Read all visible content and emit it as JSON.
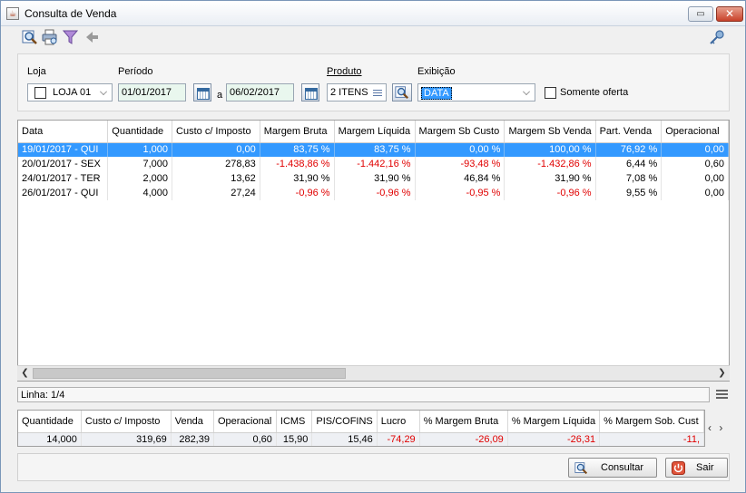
{
  "window": {
    "title": "Consulta de Venda",
    "title_icon": "java-cup-icon"
  },
  "toolbar": {
    "icons": [
      "search-icon",
      "print-icon",
      "filter-icon",
      "back-arrow-icon",
      "key-icon"
    ]
  },
  "filters": {
    "loja_label": "Loja",
    "loja_value": "LOJA 01",
    "periodo_label": "Período",
    "date_from": "01/01/2017",
    "a_label": "a",
    "date_to": "06/02/2017",
    "produto_label": "Produto",
    "produto_value": "2 ITENS",
    "exibicao_label": "Exibição",
    "exibicao_value": "DATA",
    "somente_oferta_label": "Somente oferta"
  },
  "grid": {
    "columns": [
      "Data",
      "Quantidade",
      "Custo c/ Imposto",
      "Margem Bruta",
      "Margem Líquida",
      "Margem Sb Custo",
      "Margem Sb Venda",
      "Part. Venda",
      "Operacional"
    ],
    "rows": [
      [
        "19/01/2017 - QUI",
        "1,000",
        "0,00",
        "83,75 %",
        "83,75 %",
        "0,00 %",
        "100,00 %",
        "76,92 %",
        "0,00"
      ],
      [
        "20/01/2017 - SEX",
        "7,000",
        "278,83",
        "-1.438,86 %",
        "-1.442,16 %",
        "-93,48 %",
        "-1.432,86 %",
        "6,44 %",
        "0,60"
      ],
      [
        "24/01/2017 - TER",
        "2,000",
        "13,62",
        "31,90 %",
        "31,90 %",
        "46,84 %",
        "31,90 %",
        "7,08 %",
        "0,00"
      ],
      [
        "26/01/2017 - QUI",
        "4,000",
        "27,24",
        "-0,96 %",
        "-0,96 %",
        "-0,95 %",
        "-0,96 %",
        "9,55 %",
        "0,00"
      ]
    ]
  },
  "status": {
    "linha": "Linha: 1/4"
  },
  "totals": {
    "columns": [
      "Quantidade",
      "Custo c/ Imposto",
      "Venda",
      "Operacional",
      "ICMS",
      "PIS/COFINS",
      "Lucro",
      "% Margem Bruta",
      "% Margem Líquida",
      "% Margem Sob. Cust"
    ],
    "values": [
      "14,000",
      "319,69",
      "282,39",
      "0,60",
      "15,90",
      "15,46",
      "-74,29",
      "-26,09",
      "-26,31",
      "-11,"
    ]
  },
  "buttons": {
    "consultar": "Consultar",
    "sair": "Sair"
  },
  "colors": {
    "selection": "#3399ff",
    "negative": "#e00000",
    "date_field": "#e9f7ee"
  }
}
